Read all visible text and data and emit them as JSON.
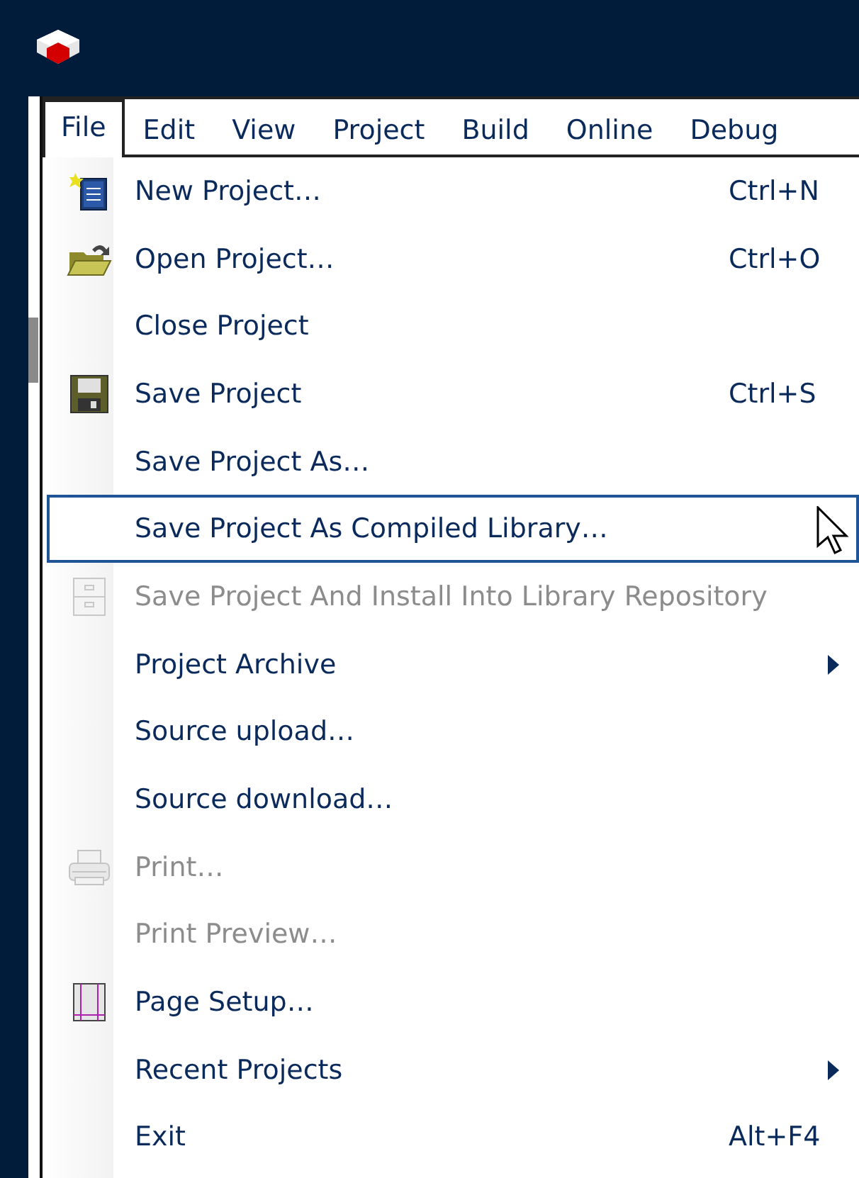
{
  "menubar": [
    {
      "label": "File",
      "selected": true
    },
    {
      "label": "Edit",
      "selected": false
    },
    {
      "label": "View",
      "selected": false
    },
    {
      "label": "Project",
      "selected": false
    },
    {
      "label": "Build",
      "selected": false
    },
    {
      "label": "Online",
      "selected": false
    },
    {
      "label": "Debug",
      "selected": false
    }
  ],
  "file_menu": [
    {
      "kind": "command",
      "label": "New Project…",
      "shortcut": "Ctrl+N",
      "disabled": false,
      "selected": false
    },
    {
      "kind": "command",
      "label": "Open Project…",
      "shortcut": "Ctrl+O",
      "disabled": false,
      "selected": false
    },
    {
      "kind": "command",
      "label": "Close Project",
      "disabled": false,
      "selected": false
    },
    {
      "kind": "command",
      "label": "Save Project",
      "shortcut": "Ctrl+S",
      "disabled": false,
      "selected": false
    },
    {
      "kind": "command",
      "label": "Save Project As…",
      "disabled": false,
      "selected": false
    },
    {
      "kind": "command",
      "label": "Save Project As Compiled Library…",
      "disabled": false,
      "selected": true
    },
    {
      "kind": "command",
      "label": "Save Project And Install Into Library Repository",
      "disabled": true,
      "selected": false
    },
    {
      "kind": "submenu",
      "label": "Project Archive",
      "disabled": false,
      "selected": false
    },
    {
      "kind": "command",
      "label": "Source upload…",
      "disabled": false,
      "selected": false
    },
    {
      "kind": "command",
      "label": "Source download…",
      "disabled": false,
      "selected": false
    },
    {
      "kind": "command",
      "label": "Print…",
      "disabled": true,
      "selected": false
    },
    {
      "kind": "command",
      "label": "Print Preview…",
      "disabled": true,
      "selected": false
    },
    {
      "kind": "command",
      "label": "Page Setup…",
      "disabled": false,
      "selected": false
    },
    {
      "kind": "submenu",
      "label": "Recent Projects",
      "disabled": false,
      "selected": false
    },
    {
      "kind": "command",
      "label": "Exit",
      "shortcut": "Alt+F4",
      "disabled": false,
      "selected": false
    }
  ]
}
